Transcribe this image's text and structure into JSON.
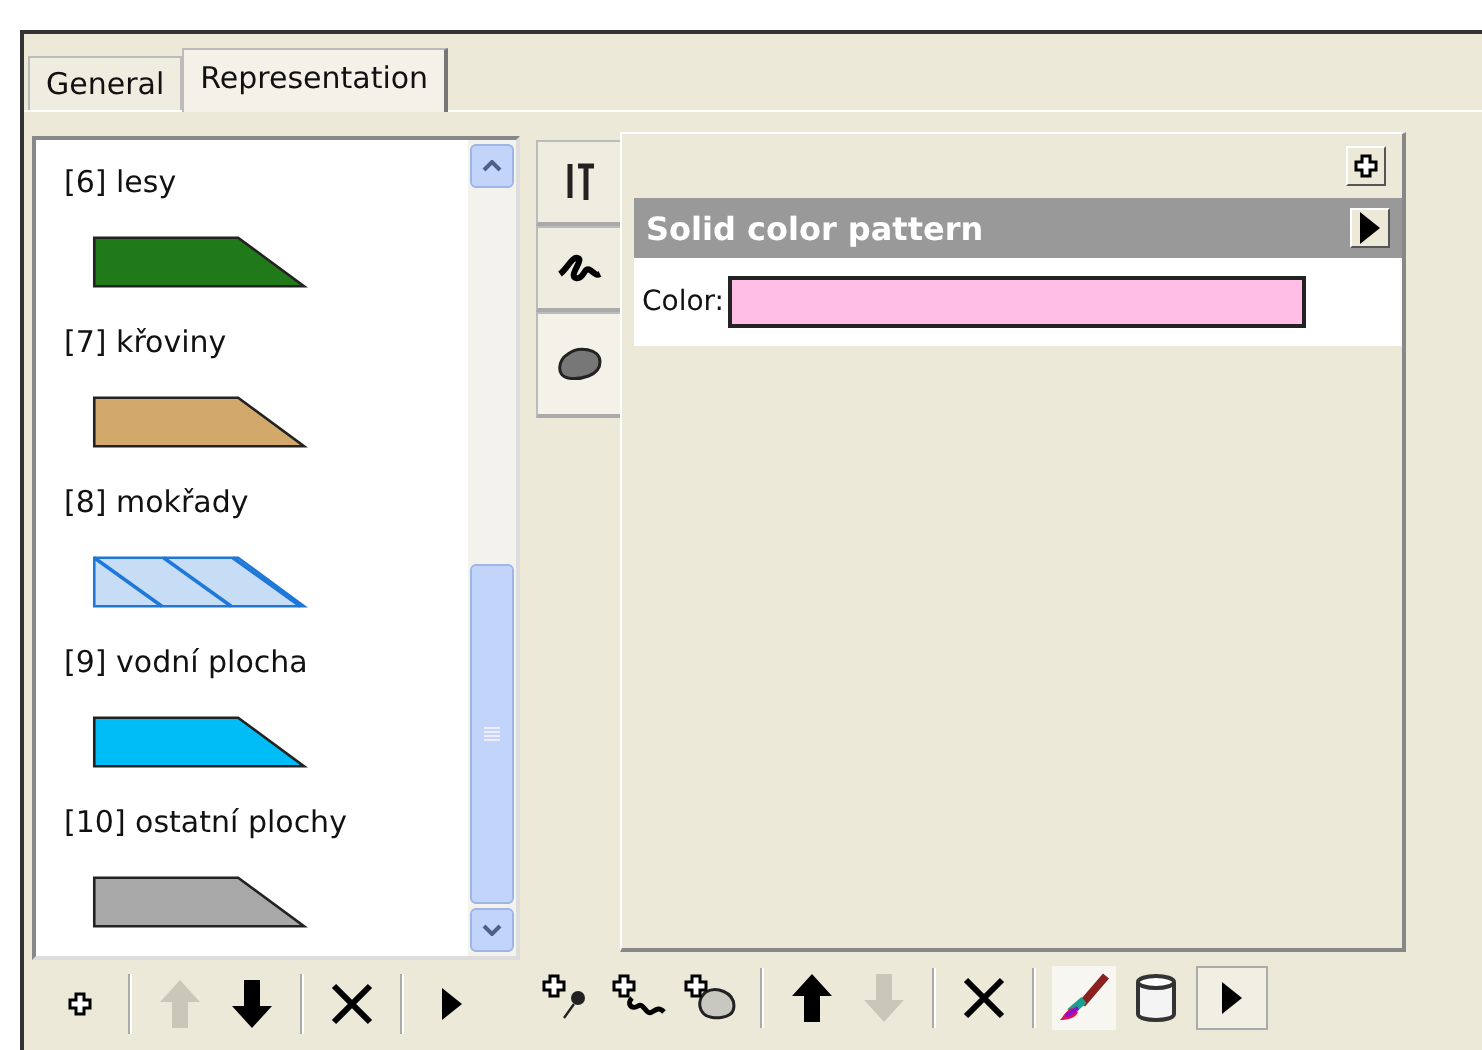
{
  "tabs": [
    {
      "label": "General",
      "selected": false
    },
    {
      "label": "Representation",
      "selected": true
    }
  ],
  "legend": [
    {
      "label": "[6] lesy",
      "kind": "solid",
      "color": "#217a1a"
    },
    {
      "label": "[7] křoviny",
      "kind": "solid",
      "color": "#d2a96a"
    },
    {
      "label": "[8] mokřady",
      "kind": "hatched",
      "color": "#1e78d8"
    },
    {
      "label": "[9] vodní plocha",
      "kind": "solid",
      "color": "#00bdf8"
    },
    {
      "label": "[10] ostatní plochy",
      "kind": "solid",
      "color": "#a8a8a8"
    }
  ],
  "left_toolbar": [
    {
      "kind": "add",
      "disabled": false
    },
    {
      "kind": "separator"
    },
    {
      "kind": "up",
      "disabled": true
    },
    {
      "kind": "down",
      "disabled": false
    },
    {
      "kind": "separator"
    },
    {
      "kind": "delete",
      "disabled": false
    },
    {
      "kind": "separator"
    },
    {
      "kind": "more",
      "disabled": false
    }
  ],
  "side_tabs": [
    {
      "kind": "tools",
      "selected": false
    },
    {
      "kind": "line",
      "selected": false
    },
    {
      "kind": "area",
      "selected": true
    }
  ],
  "pattern": {
    "title": "Solid color pattern",
    "field_label": "Color:",
    "color": "#ffbee6"
  },
  "right_toolbar": [
    {
      "kind": "add_point",
      "disabled": false,
      "pressed": false
    },
    {
      "kind": "add_line",
      "disabled": false,
      "pressed": false
    },
    {
      "kind": "add_area",
      "disabled": false,
      "pressed": false
    },
    {
      "kind": "separator"
    },
    {
      "kind": "up",
      "disabled": false,
      "pressed": false
    },
    {
      "kind": "down",
      "disabled": true,
      "pressed": false
    },
    {
      "kind": "separator"
    },
    {
      "kind": "delete",
      "disabled": false,
      "pressed": false
    },
    {
      "kind": "separator"
    },
    {
      "kind": "brush",
      "disabled": false,
      "pressed": true
    },
    {
      "kind": "cylinder",
      "disabled": false,
      "pressed": false
    },
    {
      "kind": "more_button",
      "disabled": false,
      "pressed": false
    }
  ]
}
